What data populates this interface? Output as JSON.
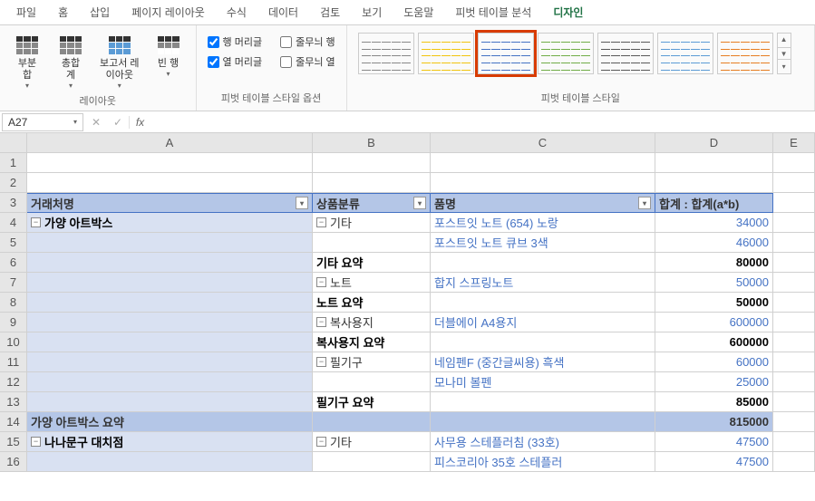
{
  "menu": {
    "items": [
      "파일",
      "홈",
      "삽입",
      "페이지 레이아웃",
      "수식",
      "데이터",
      "검토",
      "보기",
      "도움말",
      "피벗 테이블 분석",
      "디자인"
    ],
    "active_index": 10
  },
  "ribbon": {
    "layout": {
      "group_label": "레이아웃",
      "buttons": [
        {
          "label": "부분\n합",
          "name": "subtotals-button"
        },
        {
          "label": "총합\n계",
          "name": "grand-totals-button"
        },
        {
          "label": "보고서 레\n이아웃",
          "name": "report-layout-button"
        },
        {
          "label": "빈 행",
          "name": "blank-rows-button"
        }
      ]
    },
    "style_options": {
      "group_label": "피벗 테이블 스타일 옵션",
      "checkboxes": [
        {
          "label": "행 머리글",
          "checked": true,
          "name": "row-headers-checkbox"
        },
        {
          "label": "줄무늬 행",
          "checked": false,
          "name": "banded-rows-checkbox"
        },
        {
          "label": "열 머리글",
          "checked": true,
          "name": "column-headers-checkbox"
        },
        {
          "label": "줄무늬 열",
          "checked": false,
          "name": "banded-columns-checkbox"
        }
      ]
    },
    "styles": {
      "group_label": "피벗 테이블 스타일",
      "selected_index": 2,
      "colors": [
        "#888888",
        "#f1c40f",
        "#4472c4",
        "#70ad47",
        "#595959",
        "#5b9bd5",
        "#e67e22"
      ]
    }
  },
  "formula_bar": {
    "name_box": "A27",
    "formula": ""
  },
  "sheet": {
    "columns": [
      "A",
      "B",
      "C",
      "D",
      "E"
    ],
    "header_row": 3,
    "headers": [
      {
        "label": "거래처명",
        "filter": true
      },
      {
        "label": "상품분류",
        "filter": true
      },
      {
        "label": "품명",
        "filter": true
      },
      {
        "label": "합계 : 합계(a*b)",
        "filter": false
      }
    ],
    "rows": [
      {
        "n": 1,
        "type": "empty"
      },
      {
        "n": 2,
        "type": "empty"
      },
      {
        "n": 3,
        "type": "header"
      },
      {
        "n": 4,
        "type": "data",
        "a": "가양 아트박스",
        "a_expand": true,
        "b": "기타",
        "b_expand": true,
        "c": "포스트잇 노트 (654) 노랑",
        "d": "34000"
      },
      {
        "n": 5,
        "type": "data",
        "a": "",
        "b": "",
        "c": "포스트잇 노트 큐브 3색",
        "d": "46000"
      },
      {
        "n": 6,
        "type": "subtotal",
        "a": "",
        "b": "기타 요약",
        "c": "",
        "d": "80000"
      },
      {
        "n": 7,
        "type": "data",
        "a": "",
        "b": "노트",
        "b_expand": true,
        "c": "합지 스프링노트",
        "d": "50000"
      },
      {
        "n": 8,
        "type": "subtotal",
        "a": "",
        "b": "노트 요약",
        "c": "",
        "d": "50000"
      },
      {
        "n": 9,
        "type": "data",
        "a": "",
        "b": "복사용지",
        "b_expand": true,
        "c": "더블에이 A4용지",
        "d": "600000"
      },
      {
        "n": 10,
        "type": "subtotal",
        "a": "",
        "b": "복사용지 요약",
        "c": "",
        "d": "600000"
      },
      {
        "n": 11,
        "type": "data",
        "a": "",
        "b": "필기구",
        "b_expand": true,
        "c": "네임펜F (중간글씨용) 흑색",
        "d": "60000"
      },
      {
        "n": 12,
        "type": "data",
        "a": "",
        "b": "",
        "c": "모나미 볼펜",
        "d": "25000"
      },
      {
        "n": 13,
        "type": "subtotal",
        "a": "",
        "b": "필기구 요약",
        "c": "",
        "d": "85000"
      },
      {
        "n": 14,
        "type": "grandtotal",
        "a": "가양 아트박스 요약",
        "b": "",
        "c": "",
        "d": "815000"
      },
      {
        "n": 15,
        "type": "data",
        "a": "나나문구 대치점",
        "a_expand": true,
        "b": "기타",
        "b_expand": true,
        "c": "사무용 스테플러침 (33호)",
        "d": "47500"
      },
      {
        "n": 16,
        "type": "data",
        "a": "",
        "b": "",
        "c": "피스코리아 35호 스테플러",
        "d": "47500"
      }
    ]
  }
}
